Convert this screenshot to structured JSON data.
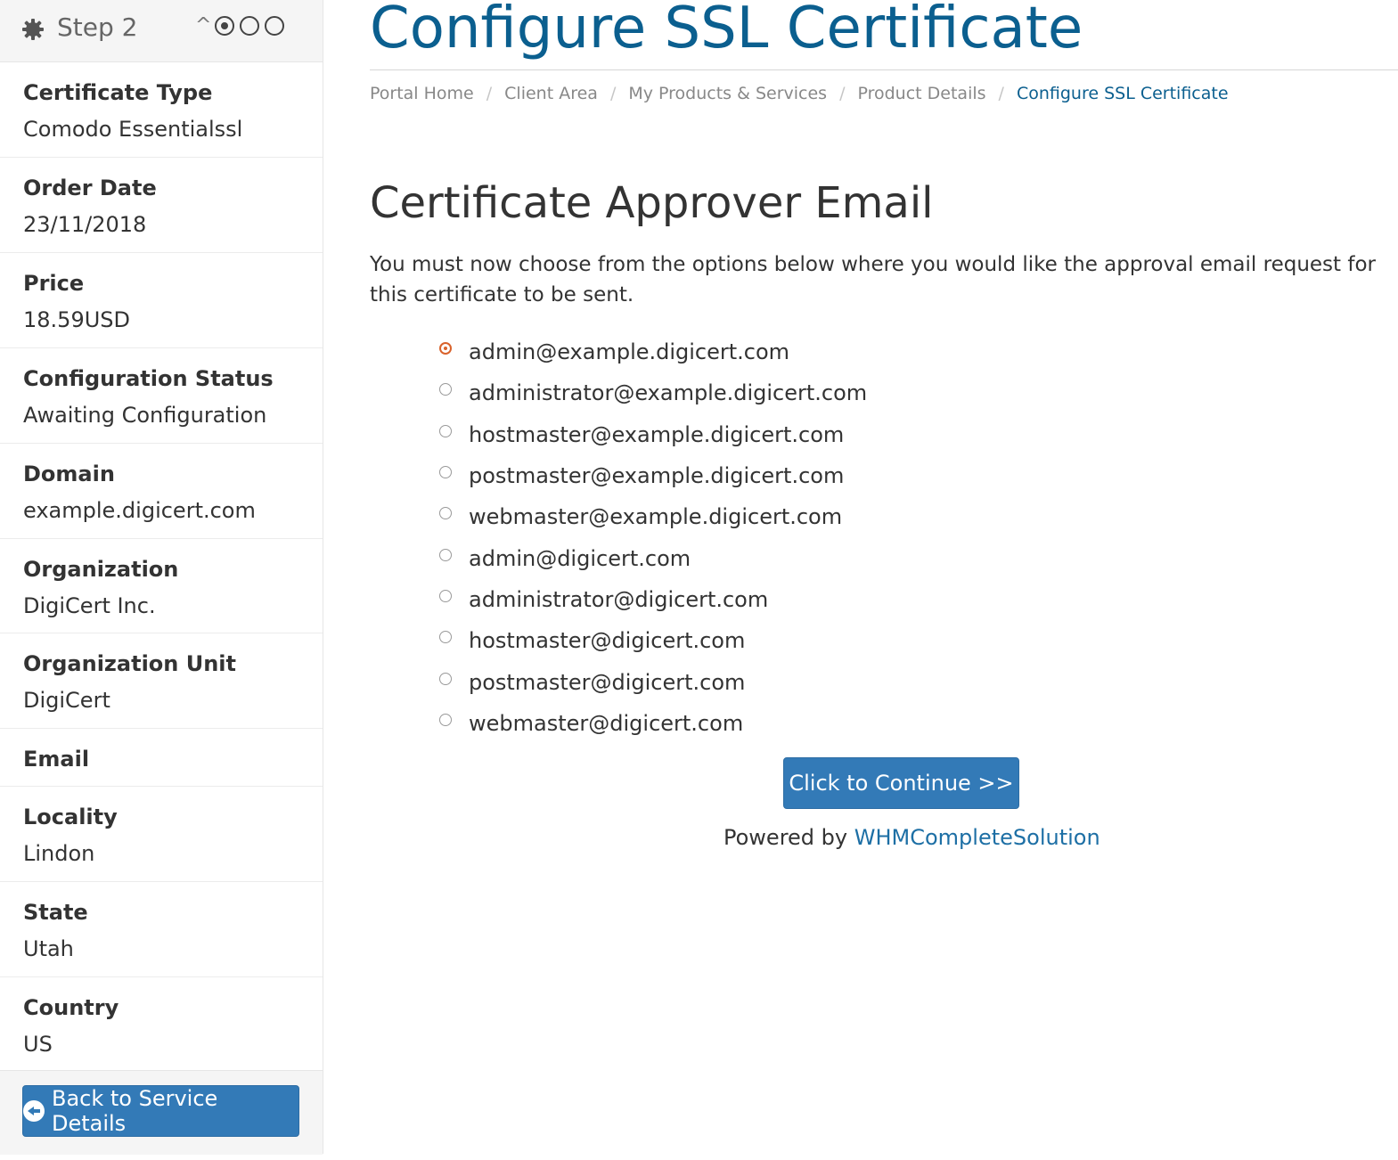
{
  "sidebar": {
    "step_label": "Step 2",
    "items": [
      {
        "label": "Certificate Type",
        "value": "Comodo Essentialssl"
      },
      {
        "label": "Order Date",
        "value": "23/11/2018"
      },
      {
        "label": "Price",
        "value": "18.59USD"
      },
      {
        "label": "Configuration Status",
        "value": "Awaiting Configuration"
      },
      {
        "label": "Domain",
        "value": "example.digicert.com"
      },
      {
        "label": "Organization",
        "value": "DigiCert Inc."
      },
      {
        "label": "Organization Unit",
        "value": "DigiCert"
      },
      {
        "label": "Email",
        "value": ""
      },
      {
        "label": "Locality",
        "value": "Lindon"
      },
      {
        "label": "State",
        "value": "Utah"
      },
      {
        "label": "Country",
        "value": "US"
      }
    ],
    "back_button": "Back to Service Details"
  },
  "main": {
    "title": "Configure SSL Certificate",
    "breadcrumb": [
      "Portal Home",
      "Client Area",
      "My Products & Services",
      "Product Details",
      "Configure SSL Certificate"
    ],
    "section_title": "Certificate Approver Email",
    "intro": "You must now choose from the options below where you would like the approval email request for this certificate to be sent.",
    "emails": [
      "admin@example.digicert.com",
      "administrator@example.digicert.com",
      "hostmaster@example.digicert.com",
      "postmaster@example.digicert.com",
      "webmaster@example.digicert.com",
      "admin@digicert.com",
      "administrator@digicert.com",
      "hostmaster@digicert.com",
      "postmaster@digicert.com",
      "webmaster@digicert.com"
    ],
    "selected_email": "admin@example.digicert.com",
    "continue_button": "Click to Continue >>",
    "powered_by": "Powered by",
    "powered_link": "WHMCompleteSolution"
  },
  "colors": {
    "accent": "#337ab7",
    "title": "#0b5f8f",
    "radio_checked": "#d9622b"
  }
}
